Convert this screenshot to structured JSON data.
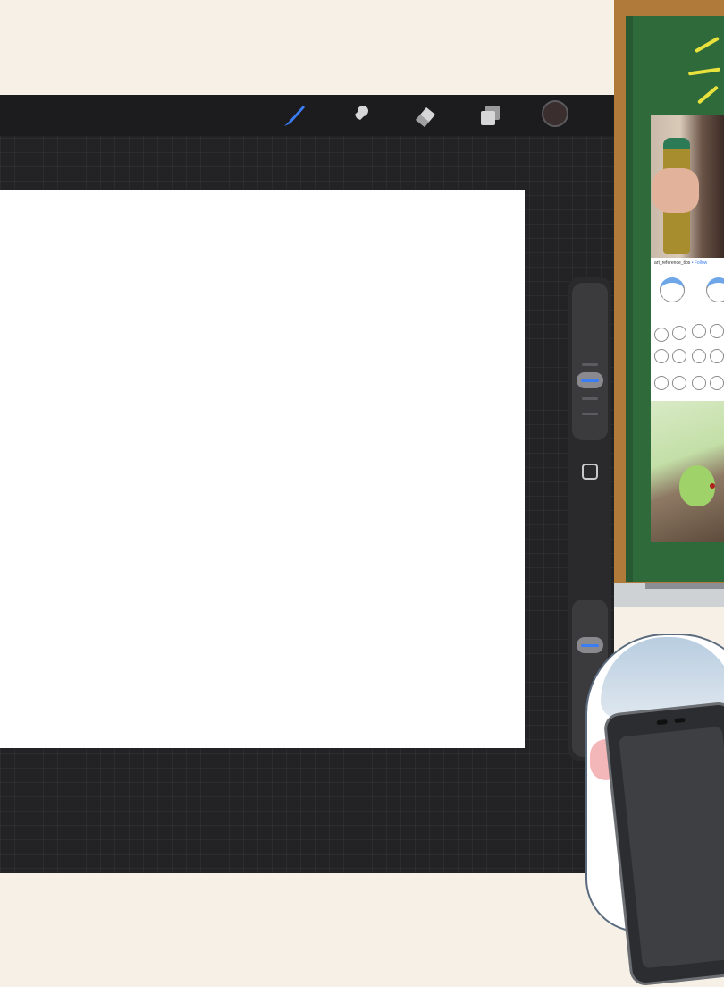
{
  "toolbar": {
    "tools": [
      {
        "name": "brush-icon",
        "active": true
      },
      {
        "name": "smudge-icon",
        "active": false
      },
      {
        "name": "eraser-icon",
        "active": false
      },
      {
        "name": "layers-icon",
        "active": false
      }
    ],
    "color_swatch": "#3a2e2e",
    "active_color": "#3a7df5"
  },
  "sidebar": {
    "brush_size_level": 0.6,
    "opacity_level": 0.2
  },
  "reference_board": {
    "sheet_title": "art_reference_tips",
    "sheet_follow": "• Follow"
  }
}
